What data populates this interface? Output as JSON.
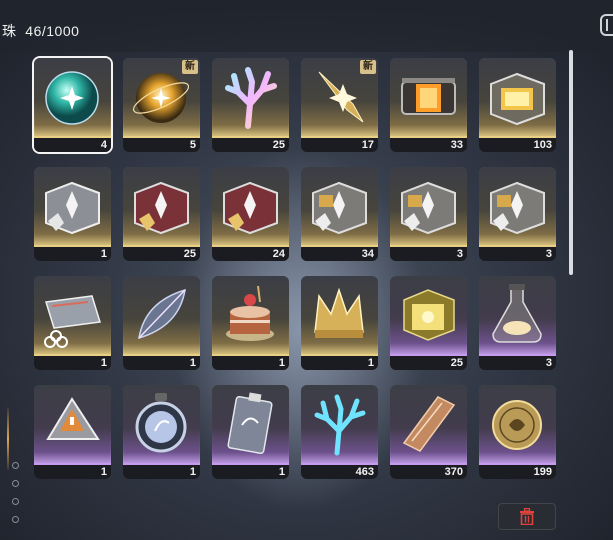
{
  "header": {
    "bag_label": "珠",
    "capacity": "46/1000"
  },
  "items": [
    {
      "icon": "teal-orb-icon",
      "count": "4",
      "rarity": "gold",
      "is_new": false,
      "selected": true
    },
    {
      "icon": "golden-orb-icon",
      "count": "5",
      "rarity": "gold",
      "is_new": true,
      "selected": false
    },
    {
      "icon": "iridescent-coral-icon",
      "count": "25",
      "rarity": "gold",
      "is_new": false,
      "selected": false
    },
    {
      "icon": "golden-blade-shard-icon",
      "count": "17",
      "rarity": "gold",
      "is_new": true,
      "selected": false
    },
    {
      "icon": "glowing-orange-crate-icon",
      "count": "33",
      "rarity": "gold",
      "is_new": false,
      "selected": false
    },
    {
      "icon": "golden-supply-box-icon",
      "count": "103",
      "rarity": "gold",
      "is_new": false,
      "selected": false
    },
    {
      "icon": "silver-supply-box-icon",
      "count": "1",
      "rarity": "gold",
      "is_new": false,
      "selected": false
    },
    {
      "icon": "red-supply-box-icon",
      "count": "25",
      "rarity": "gold",
      "is_new": false,
      "selected": false
    },
    {
      "icon": "red-supply-box-icon",
      "count": "24",
      "rarity": "gold",
      "is_new": false,
      "selected": false
    },
    {
      "icon": "gold-trim-supply-box-icon",
      "count": "34",
      "rarity": "gold",
      "is_new": false,
      "selected": false
    },
    {
      "icon": "gold-trim-supply-box-icon",
      "count": "3",
      "rarity": "gold",
      "is_new": false,
      "selected": false
    },
    {
      "icon": "gold-trim-supply-box-icon",
      "count": "3",
      "rarity": "gold",
      "is_new": false,
      "selected": false
    },
    {
      "icon": "access-card-icon",
      "count": "1",
      "rarity": "gold",
      "is_new": false,
      "selected": false
    },
    {
      "icon": "crystal-leaf-icon",
      "count": "1",
      "rarity": "gold",
      "is_new": false,
      "selected": false
    },
    {
      "icon": "cake-icon",
      "count": "1",
      "rarity": "gold",
      "is_new": false,
      "selected": false
    },
    {
      "icon": "golden-crown-icon",
      "count": "1",
      "rarity": "gold",
      "is_new": false,
      "selected": false
    },
    {
      "icon": "glowing-cube-icon",
      "count": "25",
      "rarity": "purple",
      "is_new": false,
      "selected": false
    },
    {
      "icon": "glass-flask-icon",
      "count": "3",
      "rarity": "purple",
      "is_new": false,
      "selected": false
    },
    {
      "icon": "triangle-chest-icon",
      "count": "1",
      "rarity": "purple",
      "is_new": false,
      "selected": false
    },
    {
      "icon": "round-medallion-icon",
      "count": "1",
      "rarity": "purple",
      "is_new": false,
      "selected": false
    },
    {
      "icon": "id-badge-icon",
      "count": "1",
      "rarity": "purple",
      "is_new": false,
      "selected": false
    },
    {
      "icon": "blue-coral-icon",
      "count": "463",
      "rarity": "purple",
      "is_new": false,
      "selected": false
    },
    {
      "icon": "bronze-plate-icon",
      "count": "370",
      "rarity": "purple",
      "is_new": false,
      "selected": false
    },
    {
      "icon": "gold-coin-icon",
      "count": "199",
      "rarity": "purple",
      "is_new": false,
      "selected": false
    }
  ],
  "new_tag_label": "新",
  "colors": {
    "gold_rarity": "#e8cf84",
    "purple_rarity": "#c79af0",
    "delete_red": "#e0433c"
  },
  "footer": {
    "delete_icon": "trash-icon"
  }
}
